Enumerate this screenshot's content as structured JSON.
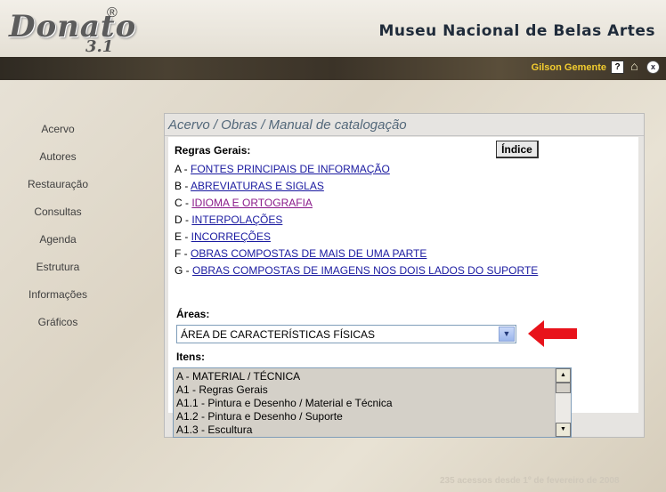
{
  "header": {
    "logo_text": "Donato",
    "logo_reg": "®",
    "logo_version": "3.1",
    "museum": "Museu Nacional de Belas Artes",
    "user": "Gilson Gemente",
    "icons": [
      "help-icon",
      "home-icon",
      "close-icon"
    ]
  },
  "sidebar": {
    "items": [
      {
        "label": "Acervo"
      },
      {
        "label": "Autores"
      },
      {
        "label": "Restauração"
      },
      {
        "label": "Consultas"
      },
      {
        "label": "Agenda"
      },
      {
        "label": "Estrutura"
      },
      {
        "label": "Informações"
      },
      {
        "label": "Gráficos"
      }
    ]
  },
  "main": {
    "breadcrumb": "Acervo / Obras / Manual de catalogação",
    "rules_title": "Regras Gerais:",
    "index_button": "Índice",
    "rules": [
      {
        "prefix": "A - ",
        "link": "FONTES PRINCIPAIS DE INFORMAÇÃO"
      },
      {
        "prefix": "B - ",
        "link": "ABREVIATURAS E SIGLAS"
      },
      {
        "prefix": "C - ",
        "link": "IDIOMA E ORTOGRAFIA"
      },
      {
        "prefix": "D - ",
        "link": "INTERPOLAÇÕES"
      },
      {
        "prefix": "E - ",
        "link": "INCORREÇÕES"
      },
      {
        "prefix": "F - ",
        "link": "OBRAS COMPOSTAS DE MAIS DE UMA PARTE"
      },
      {
        "prefix": "G - ",
        "link": "OBRAS COMPOSTAS DE IMAGENS NOS DOIS LADOS DO SUPORTE"
      }
    ],
    "areas_label": "Áreas:",
    "areas_selected": "ÁREA DE CARACTERÍSTICAS FÍSICAS",
    "itens_label": "Itens:",
    "itens": [
      "A - MATERIAL / TÉCNICA",
      "A1 - Regras Gerais",
      "A1.1 - Pintura e Desenho / Material e Técnica",
      "A1.2 - Pintura e Desenho / Suporte",
      "A1.3 - Escultura"
    ]
  },
  "footer": "235 acessos desde 1º de fevereiro de 2008",
  "colors": {
    "accent_red": "#e8131b",
    "link": "#1a1aa0",
    "visited": "#8a1a8a",
    "user": "#f2cc2f"
  }
}
